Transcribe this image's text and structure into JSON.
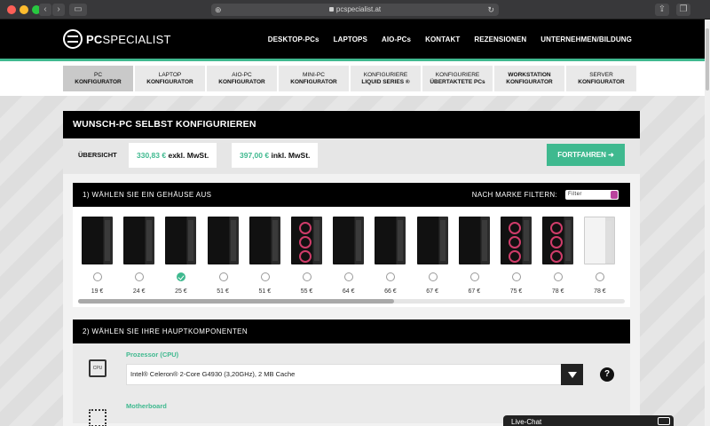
{
  "browser": {
    "url": "pcspecialist.at",
    "back_icon": "chevron-left-icon",
    "forward_icon": "chevron-right-icon"
  },
  "header": {
    "logo_bold": "PC",
    "logo_light": "SPECIALIST",
    "nav": [
      "DESKTOP-PCs",
      "LAPTOPS",
      "AIO-PCs",
      "KONTAKT",
      "REZENSIONEN",
      "UNTERNEHMEN/BILDUNG"
    ]
  },
  "subtabs": [
    {
      "l1": "PC",
      "l2": "KONFIGURATOR"
    },
    {
      "l1": "LAPTOP",
      "l2": "KONFIGURATOR"
    },
    {
      "l1": "AIO-PC",
      "l2": "KONFIGURATOR"
    },
    {
      "l1": "MINI-PC",
      "l2": "KONFIGURATOR"
    },
    {
      "l1": "KONFIGURIERE",
      "l2": "LIQUID SERIES ®"
    },
    {
      "l1": "KONFIGURIERE",
      "l2": "ÜBERTAKTETE PCs"
    },
    {
      "l1": "WORKSTATION",
      "l2": "KONFIGURATOR"
    },
    {
      "l1": "SERVER",
      "l2": "KONFIGURATOR"
    }
  ],
  "panel": {
    "title": "WUNSCH-PC SELBST KONFIGURIEREN",
    "summary_label": "ÜBERSICHT",
    "price_excl": "330,83 €",
    "price_excl_label": "exkl. MwSt.",
    "price_incl": "397,00 €",
    "price_incl_label": "inkl. MwSt.",
    "continue_label": "FORTFAHREN ➜"
  },
  "case_section": {
    "title": "1) WÄHLEN SIE EIN GEHÄUSE AUS",
    "filter_label": "NACH MARKE FILTERN:",
    "filter_value": "Filter",
    "cases": [
      {
        "price": "19 €",
        "style": "dark",
        "selected": false
      },
      {
        "price": "24 €",
        "style": "dark",
        "selected": false
      },
      {
        "price": "25 €",
        "style": "dark",
        "selected": true
      },
      {
        "price": "51 €",
        "style": "dark",
        "selected": false
      },
      {
        "price": "51 €",
        "style": "dark",
        "selected": false
      },
      {
        "price": "55 €",
        "style": "dark",
        "selected": false,
        "fans": true
      },
      {
        "price": "64 €",
        "style": "dark",
        "selected": false
      },
      {
        "price": "66 €",
        "style": "dark",
        "selected": false
      },
      {
        "price": "67 €",
        "style": "dark",
        "selected": false
      },
      {
        "price": "67 €",
        "style": "dark",
        "selected": false
      },
      {
        "price": "75 €",
        "style": "dark",
        "selected": false,
        "fans": true
      },
      {
        "price": "78 €",
        "style": "dark",
        "selected": false,
        "fans": true
      },
      {
        "price": "78 €",
        "style": "white",
        "selected": false
      }
    ]
  },
  "components_section": {
    "title": "2) WÄHLEN SIE IHRE HAUPTKOMPONENTEN",
    "cpu_label": "Prozessor (CPU)",
    "cpu_icon_text": "CPU",
    "cpu_value": "Intel® Celeron® 2-Core G4930 (3,20GHz), 2 MB Cache",
    "mb_label": "Motherboard",
    "help_text": "?"
  },
  "livechat": {
    "label": "Live-Chat"
  },
  "colors": {
    "accent": "#3fb98f",
    "header_bg": "#000000",
    "filter_accent": "#b9439d"
  }
}
